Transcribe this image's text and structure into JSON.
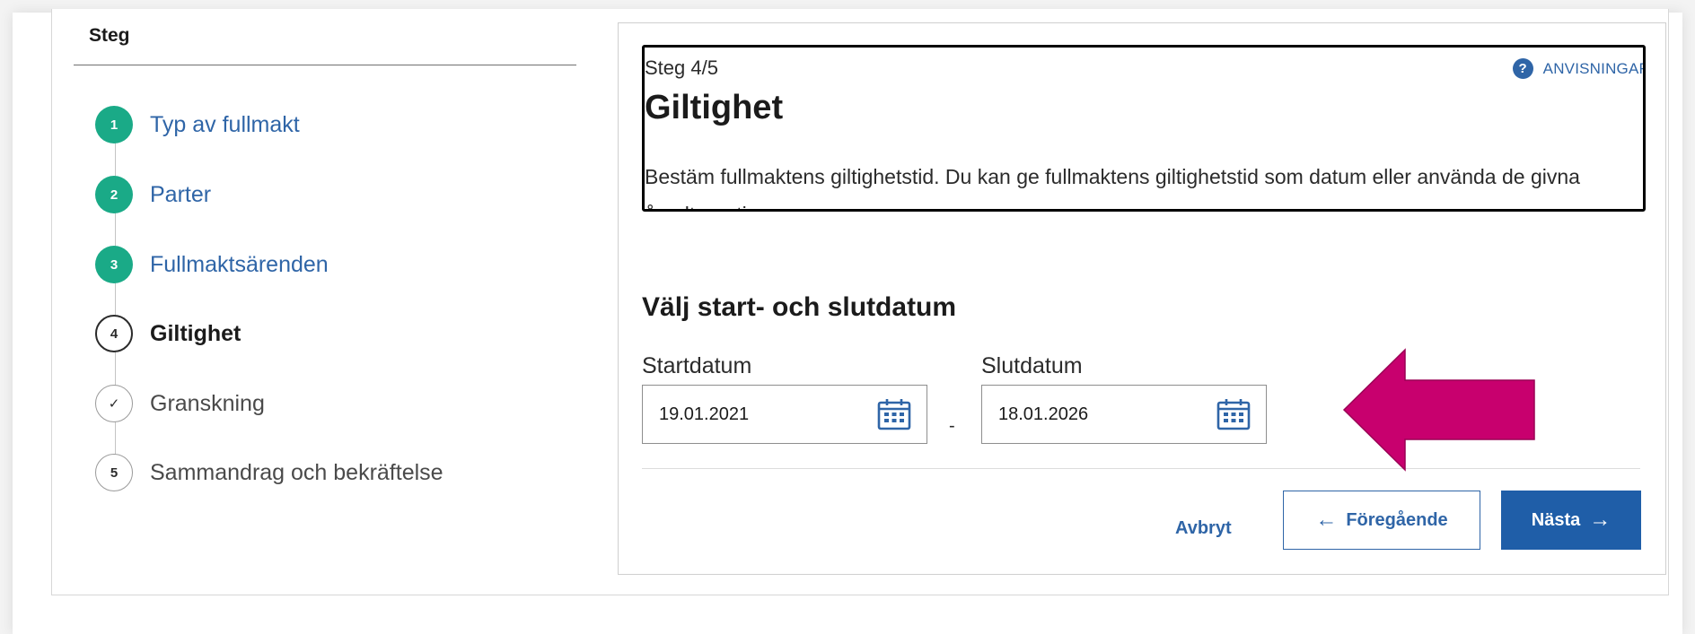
{
  "stepper": {
    "title": "Steg",
    "steps": [
      {
        "number": "1",
        "label": "Typ av fullmakt",
        "state": "done"
      },
      {
        "number": "2",
        "label": "Parter",
        "state": "done"
      },
      {
        "number": "3",
        "label": "Fullmaktsärenden",
        "state": "done"
      },
      {
        "number": "4",
        "label": "Giltighet",
        "state": "current"
      },
      {
        "number": "✓",
        "label": "Granskning",
        "state": "todo"
      },
      {
        "number": "5",
        "label": "Sammandrag och bekräftelse",
        "state": "todo"
      }
    ]
  },
  "info": {
    "step_counter": "Steg 4/5",
    "guide_link": "ANVISNINGAR",
    "guide_icon": "?",
    "heading": "Giltighet",
    "description": "Bestäm fullmaktens giltighetstid. Du kan ge fullmaktens giltighetstid som datum eller använda de givna årsalternativen."
  },
  "dates": {
    "heading": "Välj start- och slutdatum",
    "start_label": "Startdatum",
    "start_value": "19.01.2021",
    "separator": "-",
    "end_label": "Slutdatum",
    "end_value": "18.01.2026"
  },
  "actions": {
    "cancel": "Avbryt",
    "previous": "Föregående",
    "previous_arrow": "←",
    "next": "Nästa",
    "next_arrow": "→"
  },
  "colors": {
    "step_done": "#1aaa87",
    "link": "#2f65a7",
    "primary_button": "#1f5ea8",
    "annotation_arrow": "#c8006e"
  },
  "icons": {
    "calendar": "calendar-icon",
    "help": "help-icon",
    "annotation": "left-arrow-annotation"
  }
}
